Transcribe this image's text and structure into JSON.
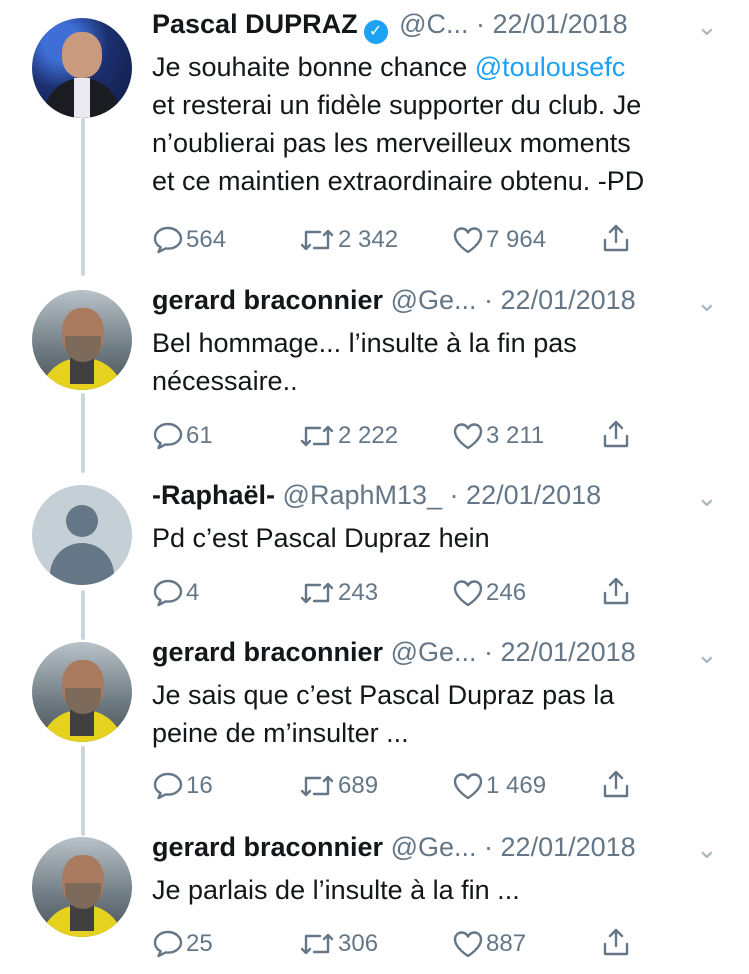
{
  "tweets": [
    {
      "name": "Pascal DUPRAZ",
      "handle": "@C...",
      "sep": " · ",
      "date": "22/01/2018",
      "verified": true,
      "text_lines": [
        {
          "before": "Je souhaite bonne chance ",
          "mention": "@toulousefc",
          "after": ""
        },
        {
          "before": "et resterai un fidèle supporter du club. Je",
          "mention": "",
          "after": ""
        },
        {
          "before": "n’oublierai pas les merveilleux moments",
          "mention": "",
          "after": ""
        },
        {
          "before": "et ce maintien extraordinaire obtenu. -PD",
          "mention": "",
          "after": ""
        }
      ],
      "replies": "564",
      "retweets": "2 342",
      "likes": "7 964"
    },
    {
      "name": "gerard braconnier",
      "handle": "@Ge...",
      "sep": " · ",
      "date": "22/01/2018",
      "verified": false,
      "text_lines": [
        {
          "before": "Bel hommage... l’insulte à la fin pas",
          "mention": "",
          "after": ""
        },
        {
          "before": "nécessaire..",
          "mention": "",
          "after": ""
        }
      ],
      "replies": "61",
      "retweets": "2 222",
      "likes": "3 211"
    },
    {
      "name": "-Raphaël-",
      "handle": "@RaphM13_",
      "sep": " · ",
      "date": "22/01/2018",
      "verified": false,
      "text_lines": [
        {
          "before": "Pd c’est Pascal Dupraz hein",
          "mention": "",
          "after": ""
        }
      ],
      "replies": "4",
      "retweets": "243",
      "likes": "246"
    },
    {
      "name": "gerard braconnier",
      "handle": "@Ge...",
      "sep": " · ",
      "date": "22/01/2018",
      "verified": false,
      "text_lines": [
        {
          "before": "Je sais que c’est Pascal Dupraz pas la",
          "mention": "",
          "after": ""
        },
        {
          "before": "peine de m’insulter ...",
          "mention": "",
          "after": ""
        }
      ],
      "replies": "16",
      "retweets": "689",
      "likes": "1 469"
    },
    {
      "name": "gerard braconnier",
      "handle": "@Ge...",
      "sep": " · ",
      "date": "22/01/2018",
      "verified": false,
      "text_lines": [
        {
          "before": "Je parlais de l’insulte à la fin ...",
          "mention": "",
          "after": ""
        }
      ],
      "replies": "25",
      "retweets": "306",
      "likes": "887"
    }
  ],
  "colors": {
    "link": "#1da1f2",
    "muted": "#657786",
    "thread_line": "#ccd6dd"
  }
}
